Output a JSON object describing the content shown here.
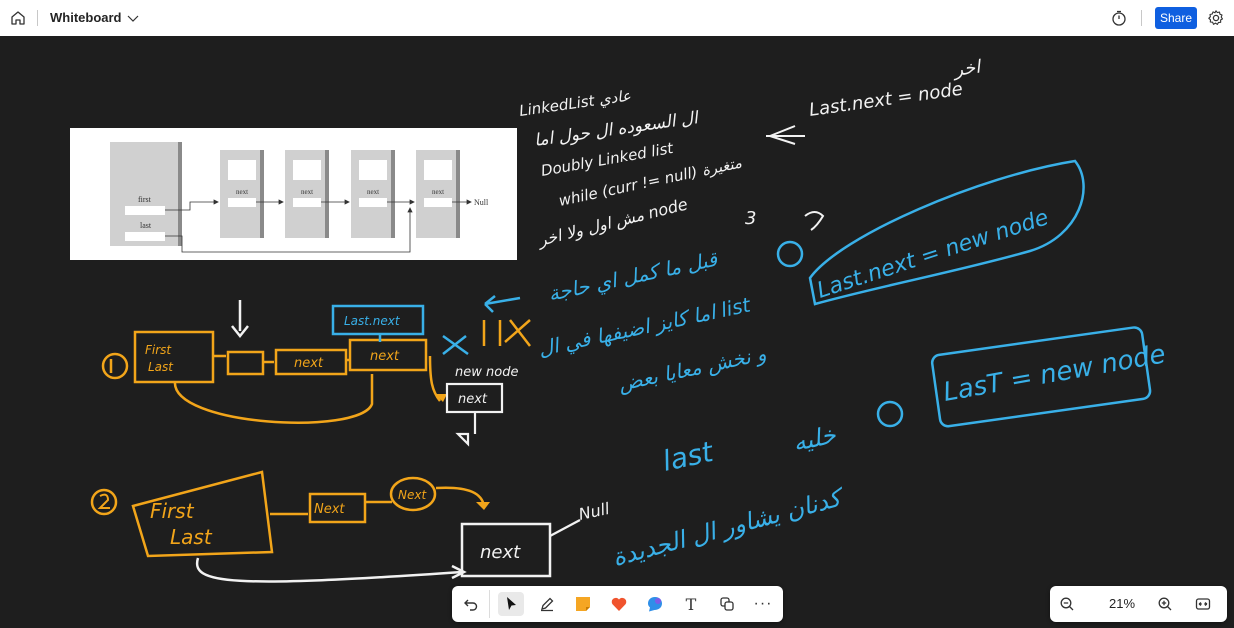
{
  "app": {
    "title": "Whiteboard"
  },
  "header": {
    "share_label": "Share"
  },
  "zoom": {
    "value": "21%"
  },
  "reference_image": {
    "labels": {
      "first": "first",
      "last": "last",
      "next": "next",
      "null": "Null"
    }
  },
  "handwriting": {
    "top_right_1": "LinkedList عادي",
    "top_right_2": "ال السعوده ال حول اما",
    "top_right_3": "Doubly Linked list",
    "top_right_4": "while (curr != null) متغيرة",
    "top_right_5": "مش اول ولا اخر node",
    "top_right_formula": "Last.next = node",
    "top_right_end": "اخر",
    "num_3": "3",
    "step1_ar_1": "قبل ما كمل اي حاجة",
    "step1_ar_2": "اما كايز اضيفها في ال list",
    "step1_ar_3": "و نخش معايا بعض",
    "step1_formula": "Last.next = new node",
    "step2_formula": "LasT = new node",
    "step2_ar_1": "last",
    "step2_ar_2": "خليه",
    "step2_ar_3": "كدنان يشاور ال الجديدة",
    "d1_first": "First",
    "d1_last": "Last",
    "d1_next1": "next",
    "d1_next2": "next",
    "d1_lastnext": "Last.next",
    "d1_newnode": "new node",
    "d1_newnext": "next",
    "d2_first": "First",
    "d2_last": "Last",
    "d2_next1": "Next",
    "d2_next2": "Next",
    "d2_null": "Null",
    "d2_newnext": "next"
  },
  "colors": {
    "accent": "#0f5fe0",
    "orange": "#f2a51a",
    "blue": "#39b0e8",
    "white_ink": "#f2f2f2"
  },
  "toolbar": {
    "undo": "undo-icon",
    "tools": [
      "select-icon",
      "pen-icon",
      "sticky-note-icon",
      "reaction-icon",
      "shape-icon",
      "text-icon",
      "copy-icon",
      "more-icon"
    ],
    "text_tool": "T",
    "more_tool": "···"
  }
}
